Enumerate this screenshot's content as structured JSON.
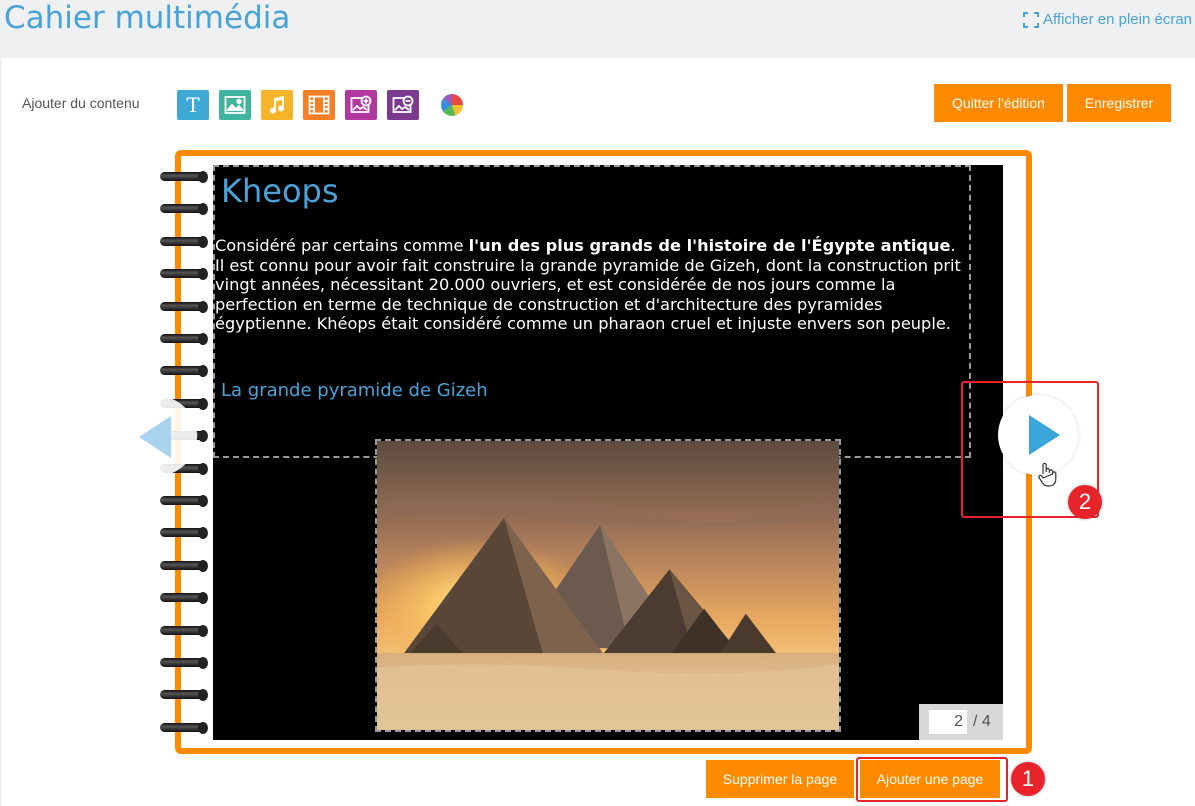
{
  "header": {
    "title": "Cahier multimédia",
    "fullscreen_label": "Afficher en plein écran"
  },
  "toolbar": {
    "add_content_label": "Ajouter du contenu",
    "tools": [
      {
        "name": "text-tool",
        "glyph": "T",
        "color": "#3fa9d6"
      },
      {
        "name": "image-tool",
        "icon": "image-icon",
        "color": "#3fb5a0"
      },
      {
        "name": "audio-tool",
        "icon": "music-note-icon",
        "color": "#f6b529"
      },
      {
        "name": "video-tool",
        "icon": "film-icon",
        "color": "#f47f24"
      },
      {
        "name": "add-media-tool",
        "icon": "add-image-icon",
        "color": "#b3379e"
      },
      {
        "name": "remove-media-tool",
        "icon": "remove-image-icon",
        "color": "#7b3a8e"
      }
    ],
    "color_picker_icon": "color-wheel-icon",
    "quit_label": "Quitter l'édition",
    "save_label": "Enregistrer"
  },
  "page": {
    "heading": "Kheops",
    "paragraph_before": "Considéré par certains comme ",
    "paragraph_bold": "l'un des plus grands de l'histoire de l'Égypte antique",
    "paragraph_after": ". Il est connu pour avoir fait construire la grande pyramide de Gizeh, dont la construction prit vingt années, nécessitant 20.000 ouvriers, et est considérée de nos jours comme la perfection en terme de technique de construction et d'architecture des pyramides égyptienne. Khéops était considéré comme un pharaon cruel et injuste envers son peuple.",
    "subheading": "La grande pyramide de Gizeh",
    "image_icon": "pyramids-photo"
  },
  "pager": {
    "current": "2",
    "total": "/ 4"
  },
  "bottom_actions": {
    "delete_label": "Supprimer la page",
    "add_label": "Ajouter une page"
  },
  "annotations": {
    "step1": "1",
    "step2": "2"
  },
  "colors": {
    "accent_orange": "#ff8a00",
    "title_blue": "#4aa3d8",
    "highlight_red": "#e8242a"
  }
}
